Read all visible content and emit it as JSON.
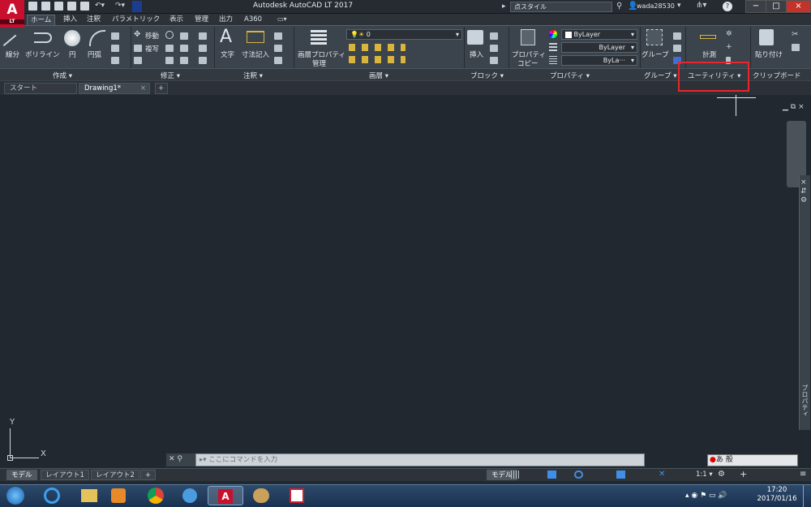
{
  "app": {
    "logo": "A",
    "logo_sub": "LT",
    "title": "Autodesk AutoCAD LT 2017"
  },
  "titlebar": {
    "search_text": "点スタイル",
    "user": "wada28530",
    "window_buttons": [
      "−",
      "□",
      "×"
    ]
  },
  "ribbon_tabs": [
    "ホーム",
    "挿入",
    "注釈",
    "パラメトリック",
    "表示",
    "管理",
    "出力",
    "A360"
  ],
  "draw": {
    "line": "線分",
    "polyline": "ポリライン",
    "circle": "円",
    "arc": "円弧"
  },
  "modify": {
    "move": "移動",
    "copy": "複写"
  },
  "annotation": {
    "text": "文字",
    "dimension": "寸法記入"
  },
  "layers": {
    "props_line1": "画層プロパティ",
    "props_line2": "管理",
    "current_layer": "0"
  },
  "block": {
    "insert": "挿入"
  },
  "properties": {
    "match_line1": "プロパティ",
    "match_line2": "コピー",
    "color": "ByLayer",
    "linetype": "ByLayer",
    "lineweight": "ByLa···"
  },
  "groups": {
    "group": "グループ"
  },
  "utilities": {
    "measure": "計測"
  },
  "clipboard": {
    "paste": "貼り付け"
  },
  "panel_labels": {
    "draw": "作成 ▾",
    "modify": "修正 ▾",
    "annotation": "注釈 ▾",
    "layers": "画層 ▾",
    "block": "ブロック ▾",
    "properties": "プロパティ ▾",
    "groups": "グループ ▾",
    "utilities": "ユーティリティ ▾",
    "clipboard": "クリップボード"
  },
  "doc_tabs": {
    "start": "スタート",
    "drawing": "Drawing1*",
    "add": "+"
  },
  "canvas": {
    "ucs_y": "Y",
    "ucs_x": "X"
  },
  "side": {
    "properties": "プロパティ"
  },
  "command": {
    "placeholder": "ここにコマンドを入力"
  },
  "layout_tabs": [
    "モデル",
    "レイアウト1",
    "レイアウト2",
    "+"
  ],
  "status": {
    "model": "モデル",
    "scale": "1:1 ▾"
  },
  "ime": {
    "text": "あ 般"
  },
  "taskbar": {
    "time": "17:20",
    "date": "2017/01/16"
  },
  "colors": {
    "accent": "#e8262b",
    "canvas": "#212830",
    "ribbon": "#3b434c"
  }
}
